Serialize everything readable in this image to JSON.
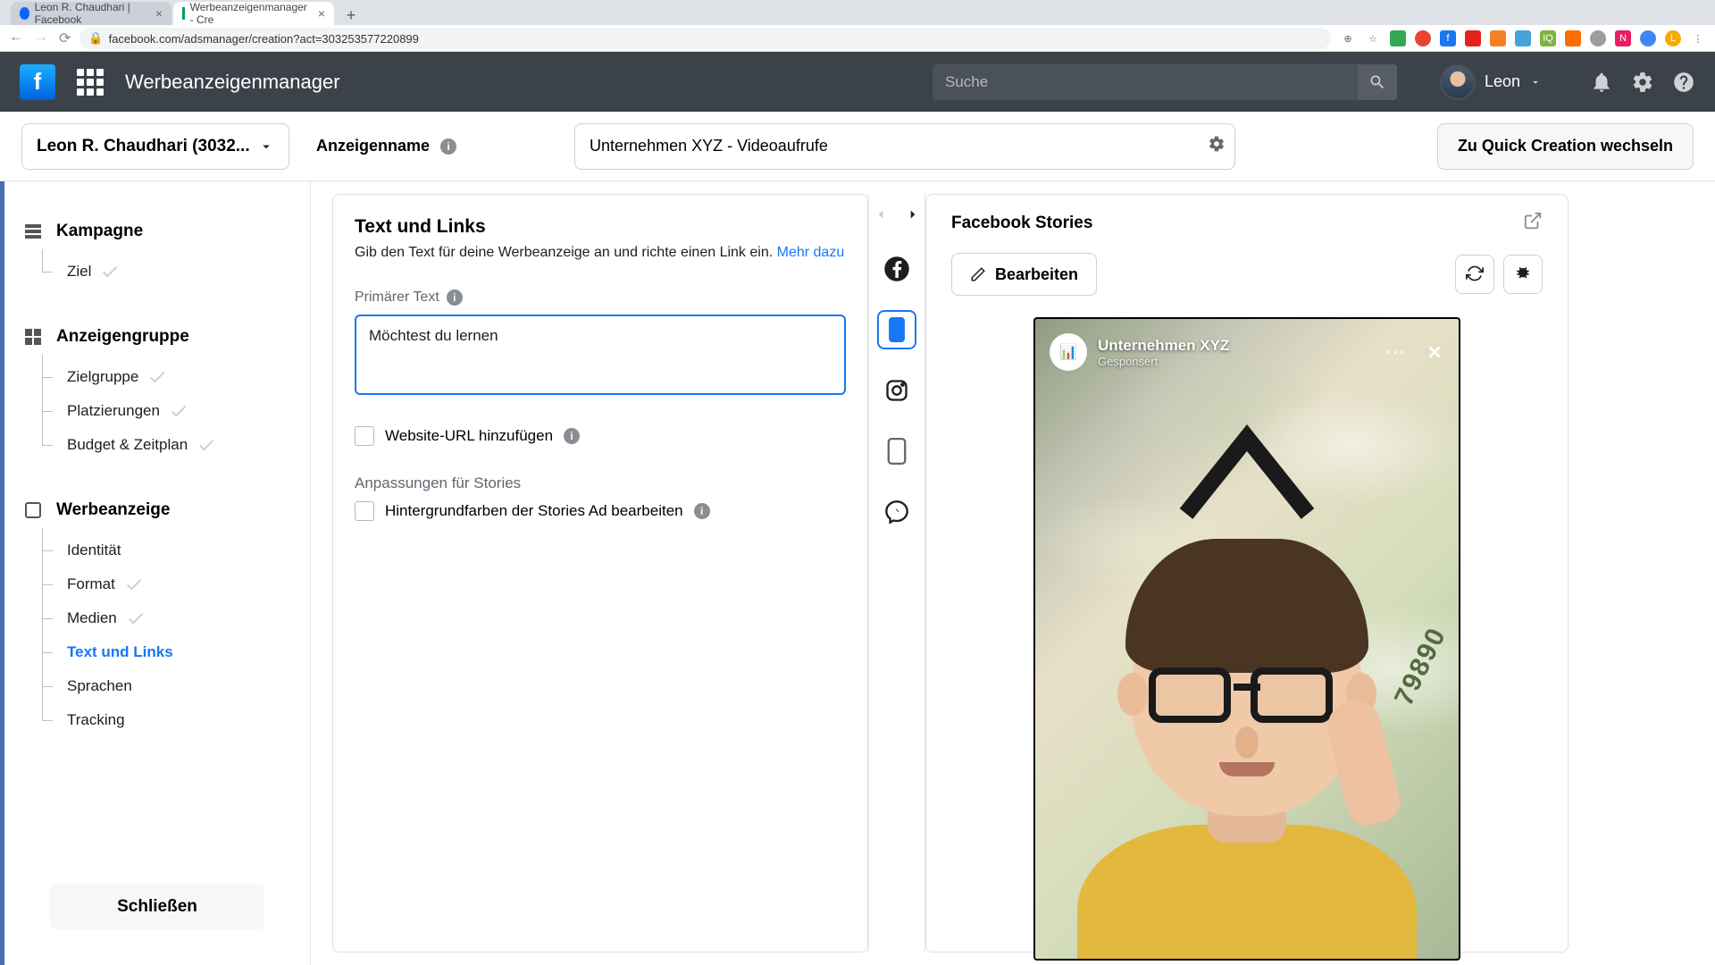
{
  "browser": {
    "tab1": "Leon R. Chaudhari | Facebook",
    "tab2": "Werbeanzeigenmanager - Cre",
    "url": "facebook.com/adsmanager/creation?act=303253577220899"
  },
  "header": {
    "title": "Werbeanzeigenmanager",
    "search_placeholder": "Suche",
    "user_name": "Leon"
  },
  "subheader": {
    "account": "Leon R. Chaudhari (3032...",
    "name_label": "Anzeigenname",
    "name_value": "Unternehmen XYZ - Videoaufrufe",
    "quick": "Zu Quick Creation wechseln"
  },
  "sidebar": {
    "campaign": "Kampagne",
    "campaign_items": [
      "Ziel"
    ],
    "adset": "Anzeigengruppe",
    "adset_items": [
      "Zielgruppe",
      "Platzierungen",
      "Budget & Zeitplan"
    ],
    "ad": "Werbeanzeige",
    "ad_items": [
      "Identität",
      "Format",
      "Medien",
      "Text und Links",
      "Sprachen",
      "Tracking"
    ],
    "active_ad_item": "Text und Links",
    "close": "Schließen"
  },
  "form": {
    "heading": "Text und Links",
    "sub": "Gib den Text für deine Werbeanzeige an und richte einen Link ein.",
    "more": "Mehr dazu",
    "primary_label": "Primärer Text",
    "primary_value": "Möchtest du lernen ",
    "url_checkbox": "Website-URL hinzufügen",
    "stories_section": "Anpassungen für Stories",
    "bg_checkbox": "Hintergrundfarben der Stories Ad bearbeiten"
  },
  "preview": {
    "title": "Facebook Stories",
    "edit": "Bearbeiten",
    "story_name": "Unternehmen XYZ",
    "story_sub": "Gesponsert",
    "serial": "79890"
  }
}
